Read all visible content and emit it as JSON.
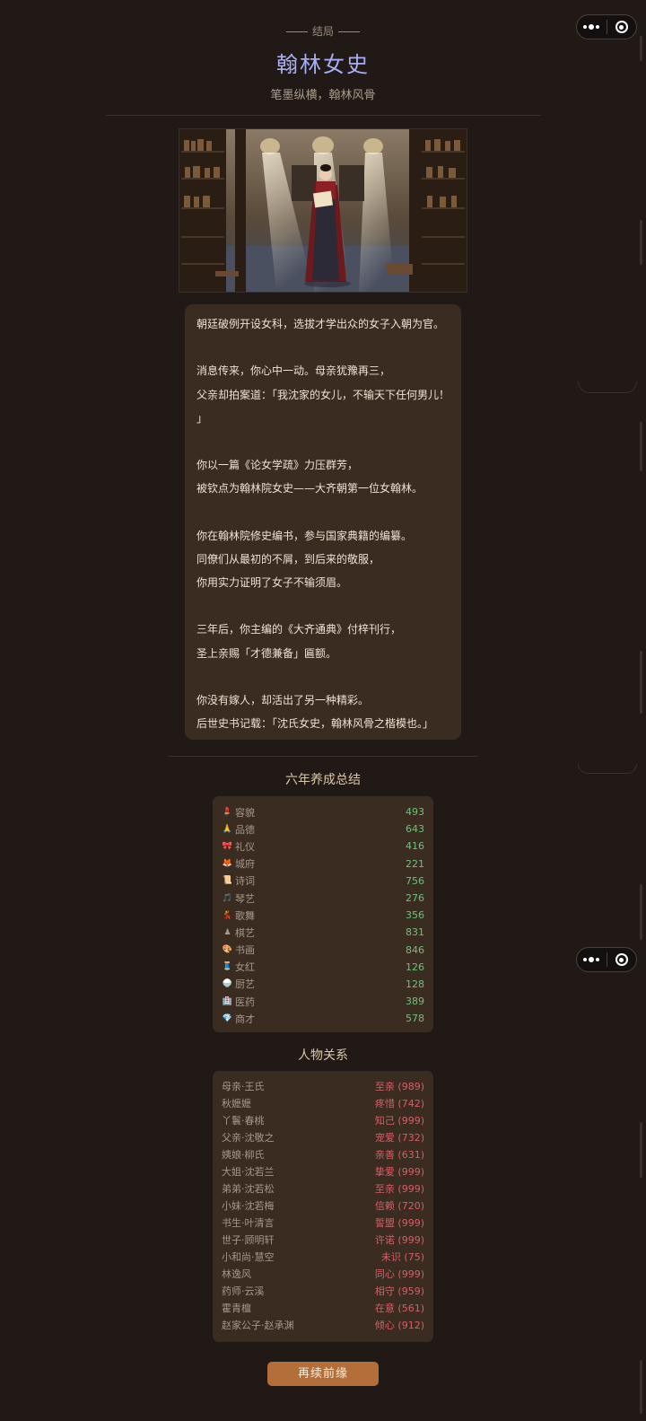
{
  "header": {
    "label": "结局",
    "title": "翰林女史",
    "subtitle": "笔墨纵横，翰林风骨"
  },
  "story": [
    "朝廷破例开设女科，选拔才学出众的女子入朝为官。",
    "",
    "消息传来，你心中一动。母亲犹豫再三，",
    "父亲却拍案道：「我沈家的女儿，不输天下任何男儿！",
    "」",
    "",
    "你以一篇《论女学疏》力压群芳，",
    "被钦点为翰林院女史——大齐朝第一位女翰林。",
    "",
    "你在翰林院修史编书，参与国家典籍的编纂。",
    "同僚们从最初的不屑，到后来的敬服，",
    "你用实力证明了女子不输须眉。",
    "",
    "三年后，你主编的《大齐通典》付梓刊行，",
    "圣上亲赐「才德兼备」匾额。",
    "",
    "你没有嫁人，却活出了另一种精彩。",
    "后世史书记载：「沈氏女史，翰林风骨之楷模也。」"
  ],
  "stats": {
    "title": "六年养成总结",
    "items": [
      {
        "icon": "💄",
        "label": "容貌",
        "value": "493"
      },
      {
        "icon": "🙏",
        "label": "品德",
        "value": "643"
      },
      {
        "icon": "🎀",
        "label": "礼仪",
        "value": "416"
      },
      {
        "icon": "🦊",
        "label": "城府",
        "value": "221"
      },
      {
        "icon": "📜",
        "label": "诗词",
        "value": "756"
      },
      {
        "icon": "🎵",
        "label": "琴艺",
        "value": "276"
      },
      {
        "icon": "💃",
        "label": "歌舞",
        "value": "356"
      },
      {
        "icon": "♟",
        "label": "棋艺",
        "value": "831"
      },
      {
        "icon": "🎨",
        "label": "书画",
        "value": "846"
      },
      {
        "icon": "🧵",
        "label": "女红",
        "value": "126"
      },
      {
        "icon": "🍚",
        "label": "厨艺",
        "value": "128"
      },
      {
        "icon": "🏥",
        "label": "医药",
        "value": "389"
      },
      {
        "icon": "💎",
        "label": "商才",
        "value": "578"
      }
    ]
  },
  "relations": {
    "title": "人物关系",
    "items": [
      {
        "name": "母亲·王氏",
        "status": "至亲 (989)"
      },
      {
        "name": "秋嬷嬷",
        "status": "疼惜 (742)"
      },
      {
        "name": "丫鬟·春桃",
        "status": "知己 (999)"
      },
      {
        "name": "父亲·沈敬之",
        "status": "宠爱 (732)"
      },
      {
        "name": "姨娘·柳氏",
        "status": "亲善 (631)"
      },
      {
        "name": "大姐·沈若兰",
        "status": "挚爱 (999)"
      },
      {
        "name": "弟弟·沈若松",
        "status": "至亲 (999)"
      },
      {
        "name": "小妹·沈若梅",
        "status": "信赖 (720)"
      },
      {
        "name": "书生·叶清言",
        "status": "誓盟 (999)"
      },
      {
        "name": "世子·顾明轩",
        "status": "许诺 (999)"
      },
      {
        "name": "小和尚·慧空",
        "status": "未识 (75)"
      },
      {
        "name": "林逸风",
        "status": "同心 (999)"
      },
      {
        "name": "药师·云溪",
        "status": "相守 (959)"
      },
      {
        "name": "霍青檀",
        "status": "在意 (561)"
      },
      {
        "name": "赵家公子·赵承渊",
        "status": "倾心 (912)"
      }
    ]
  },
  "button": {
    "label": "再续前缘"
  },
  "colors": {
    "background": "#211916",
    "card": "#3b2c22",
    "title": "#a7aef5",
    "stat_value": "#6cc27a",
    "relation_value": "#d95d66",
    "button": "#b36e3a"
  }
}
